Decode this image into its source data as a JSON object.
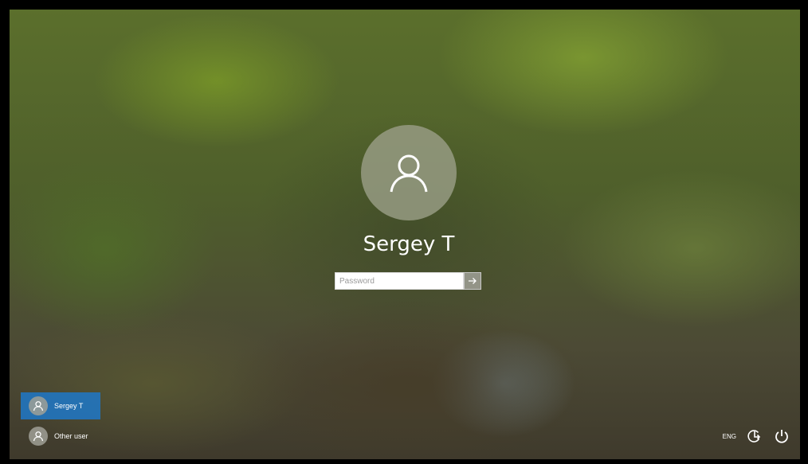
{
  "login": {
    "username": "Sergey T",
    "password_placeholder": "Password",
    "password_value": ""
  },
  "user_list": [
    {
      "name": "Sergey T",
      "selected": true
    },
    {
      "name": "Other user",
      "selected": false
    }
  ],
  "tray": {
    "language": "ENG"
  },
  "icons": {
    "avatar": "user-icon",
    "submit": "arrow-right-icon",
    "accessibility": "ease-of-access-icon",
    "power": "power-icon"
  },
  "colors": {
    "selected_user_bg": "#1e78c8",
    "text": "#ffffff"
  }
}
